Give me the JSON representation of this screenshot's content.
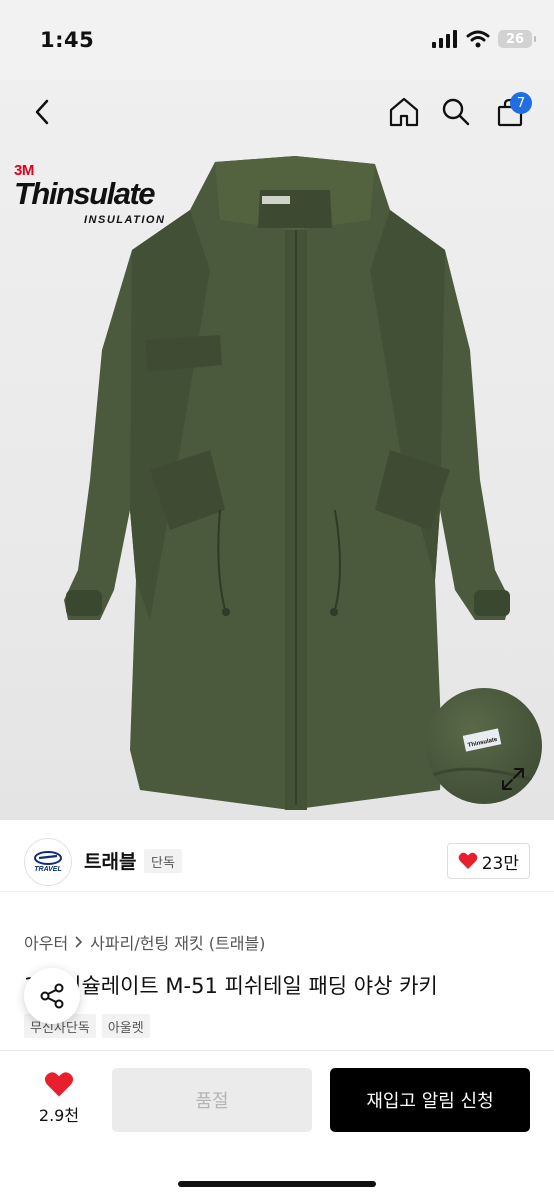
{
  "status_bar": {
    "time": "1:45",
    "battery": "26"
  },
  "nav": {
    "cart_count": "7"
  },
  "hero": {
    "logo_brand": "3M",
    "logo_name": "Thinsulate",
    "logo_sub": "INSULATION",
    "detail_label": "Thinsulate"
  },
  "seller": {
    "logo_text": "TRAVEL",
    "name": "트래블",
    "exclusive_tag": "단독",
    "likes": "23만"
  },
  "breadcrumb": {
    "category": "아우터",
    "subcategory": "사파리/헌팅 재킷 (트래블)"
  },
  "product": {
    "title": "3M 신슐레이트 M-51 피쉬테일 패딩 야상 카키",
    "tags": [
      "무신사단독",
      "아울렛"
    ]
  },
  "bottom": {
    "wish_count": "2.9천",
    "soldout_label": "품절",
    "restock_label": "재입고 알림 신청"
  },
  "colors": {
    "accent": "#1f6fe0",
    "heart": "#e8202e",
    "jacket": "#4b5a3d"
  }
}
